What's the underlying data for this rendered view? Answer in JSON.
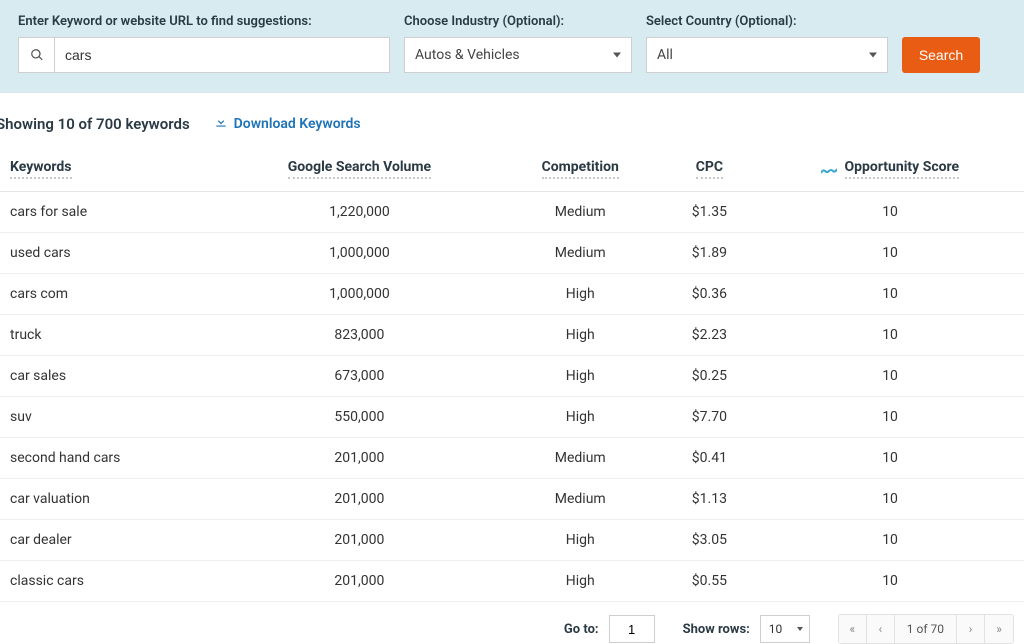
{
  "search": {
    "keyword_label": "Enter Keyword or website URL to find suggestions:",
    "keyword_value": "cars",
    "industry_label": "Choose Industry (Optional):",
    "industry_value": "Autos & Vehicles",
    "country_label": "Select Country (Optional):",
    "country_value": "All",
    "button_label": "Search"
  },
  "results": {
    "summary": "Showing 10 of 700 keywords",
    "download_label": "Download Keywords"
  },
  "columns": {
    "c0": "Keywords",
    "c1": "Google Search Volume",
    "c2": "Competition",
    "c3": "CPC",
    "c4": "Opportunity Score"
  },
  "rows": [
    {
      "keyword": "cars for sale",
      "volume": "1,220,000",
      "competition": "Medium",
      "cpc": "$1.35",
      "score": "10"
    },
    {
      "keyword": "used cars",
      "volume": "1,000,000",
      "competition": "Medium",
      "cpc": "$1.89",
      "score": "10"
    },
    {
      "keyword": "cars com",
      "volume": "1,000,000",
      "competition": "High",
      "cpc": "$0.36",
      "score": "10"
    },
    {
      "keyword": "truck",
      "volume": "823,000",
      "competition": "High",
      "cpc": "$2.23",
      "score": "10"
    },
    {
      "keyword": "car sales",
      "volume": "673,000",
      "competition": "High",
      "cpc": "$0.25",
      "score": "10"
    },
    {
      "keyword": "suv",
      "volume": "550,000",
      "competition": "High",
      "cpc": "$7.70",
      "score": "10"
    },
    {
      "keyword": "second hand cars",
      "volume": "201,000",
      "competition": "Medium",
      "cpc": "$0.41",
      "score": "10"
    },
    {
      "keyword": "car valuation",
      "volume": "201,000",
      "competition": "Medium",
      "cpc": "$1.13",
      "score": "10"
    },
    {
      "keyword": "car dealer",
      "volume": "201,000",
      "competition": "High",
      "cpc": "$3.05",
      "score": "10"
    },
    {
      "keyword": "classic cars",
      "volume": "201,000",
      "competition": "High",
      "cpc": "$0.55",
      "score": "10"
    }
  ],
  "pager": {
    "goto_label": "Go to:",
    "goto_value": "1",
    "show_rows_label": "Show rows:",
    "show_rows_value": "10",
    "page_text": "1 of 70"
  }
}
